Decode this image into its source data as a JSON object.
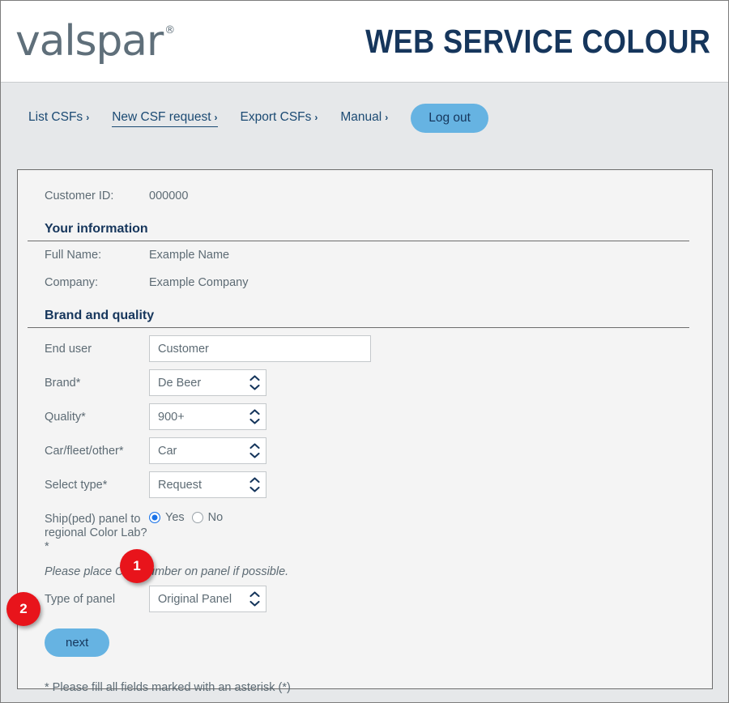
{
  "header": {
    "logo_text": "valspar",
    "logo_registered": "®",
    "app_title": "WEB SERVICE COLOUR"
  },
  "nav": {
    "items": [
      {
        "label": "List CSFs",
        "chevron": "›",
        "active": false
      },
      {
        "label": "New CSF request",
        "chevron": "›",
        "active": true
      },
      {
        "label": "Export CSFs",
        "chevron": "›",
        "active": false
      },
      {
        "label": "Manual",
        "chevron": "›",
        "active": false
      }
    ],
    "logout_label": "Log out"
  },
  "form": {
    "customer_id_label": "Customer ID:",
    "customer_id_value": "000000",
    "section_your_information": "Your information",
    "full_name_label": "Full Name:",
    "full_name_value": "Example Name",
    "company_label": "Company:",
    "company_value": "Example Company",
    "section_brand_quality": "Brand and quality",
    "end_user_label": "End user",
    "end_user_value": "Customer",
    "brand_label": "Brand*",
    "brand_value": "De Beer",
    "quality_label": "Quality*",
    "quality_value": "900+",
    "car_fleet_label": "Car/fleet/other*",
    "car_fleet_value": "Car",
    "select_type_label": "Select type*",
    "select_type_value": "Request",
    "ship_panel_label": "Ship(ped) panel to regional Color Lab?*",
    "radio_yes_label": "Yes",
    "radio_no_label": "No",
    "radio_selected": "Yes",
    "csf_note": "Please place CSF number on panel if possible.",
    "type_of_panel_label": "Type of panel",
    "type_of_panel_value": "Original Panel",
    "next_label": "next",
    "footnote": "* Please fill all fields marked with an asterisk (*)"
  },
  "annotations": [
    {
      "number": "1"
    },
    {
      "number": "2"
    }
  ],
  "colors": {
    "brand_navy": "#16365c",
    "nav_link": "#1b4a73",
    "button_blue": "#66b3e2",
    "badge_red": "#e8141b",
    "radio_blue": "#1a73e8",
    "panel_bg": "#f4f4f4",
    "page_bg": "#e6e8ea",
    "logo_grey": "#5f6f7a"
  }
}
